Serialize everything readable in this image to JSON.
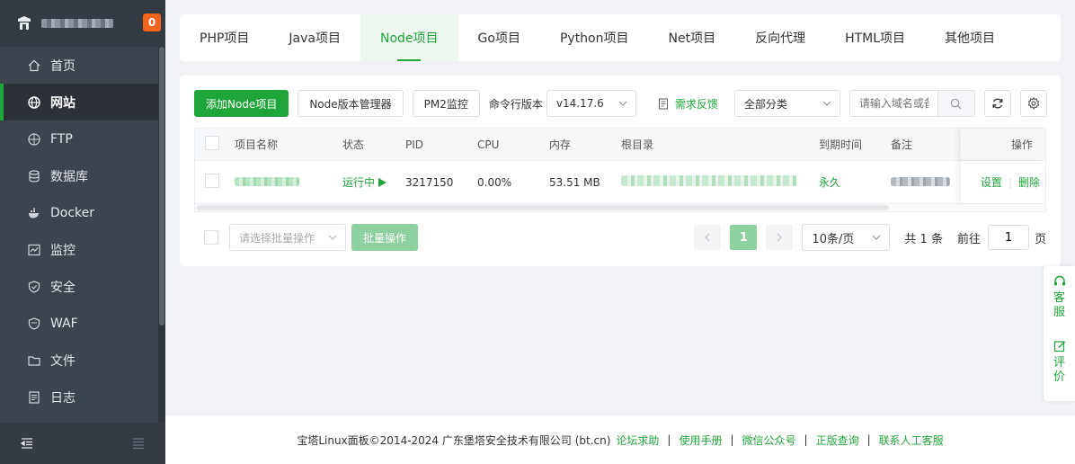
{
  "sidebar": {
    "badge": "0",
    "items": [
      {
        "label": "首页",
        "icon": "home-icon"
      },
      {
        "label": "网站",
        "icon": "globe-icon"
      },
      {
        "label": "FTP",
        "icon": "ftp-icon"
      },
      {
        "label": "数据库",
        "icon": "database-icon"
      },
      {
        "label": "Docker",
        "icon": "docker-icon"
      },
      {
        "label": "监控",
        "icon": "monitor-icon"
      },
      {
        "label": "安全",
        "icon": "shield-icon"
      },
      {
        "label": "WAF",
        "icon": "waf-icon"
      },
      {
        "label": "文件",
        "icon": "folder-icon"
      },
      {
        "label": "日志",
        "icon": "log-icon"
      }
    ]
  },
  "tabs": [
    "PHP项目",
    "Java项目",
    "Node项目",
    "Go项目",
    "Python项目",
    "Net项目",
    "反向代理",
    "HTML项目",
    "其他项目"
  ],
  "active_tab": 2,
  "toolbar": {
    "add_label": "添加Node项目",
    "version_manager_label": "Node版本管理器",
    "pm2_label": "PM2监控",
    "cli_version_label": "命令行版本",
    "cli_version_value": "v14.17.6",
    "feedback_label": "需求反馈",
    "category_value": "全部分类",
    "search_placeholder": "请输入域名或备注"
  },
  "table": {
    "headers": {
      "name": "项目名称",
      "status": "状态",
      "pid": "PID",
      "cpu": "CPU",
      "memory": "内存",
      "root": "根目录",
      "expire": "到期时间",
      "note": "备注",
      "ops": "操作"
    },
    "rows": [
      {
        "status": "运行中",
        "pid": "3217150",
        "cpu": "0.00%",
        "memory": "53.51 MB",
        "expire": "永久",
        "op_settings": "设置",
        "op_delete": "删除"
      }
    ]
  },
  "batch": {
    "select_placeholder": "请选择批量操作",
    "button_label": "批量操作"
  },
  "pagination": {
    "current_page": "1",
    "page_size": "10条/页",
    "total": "共 1 条",
    "goto_label": "前往",
    "goto_value": "1",
    "page_suffix": "页"
  },
  "float_panel": {
    "service_label": "客服",
    "rate_label": "评价"
  },
  "footer": {
    "copyright": "宝塔Linux面板©2014-2024 广东堡塔安全技术有限公司 (bt.cn)",
    "links": [
      "论坛求助",
      "使用手册",
      "微信公众号",
      "正版查询",
      "联系人工客服"
    ],
    "separator": "|"
  },
  "colors": {
    "accent": "#20a53a",
    "sidebar_bg": "#3c444d",
    "badge": "#f0641e"
  }
}
